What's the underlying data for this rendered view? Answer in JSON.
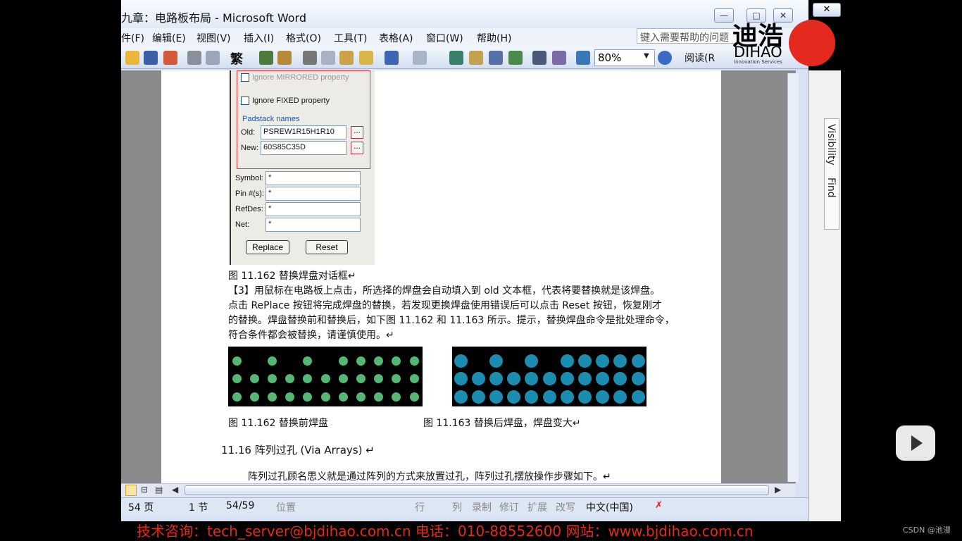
{
  "window": {
    "title": "九章：电路板布局 - Microsoft Word",
    "controls": {
      "min": "—",
      "max": "□",
      "close": "✕"
    }
  },
  "menu": {
    "items": [
      "件(F)",
      "编辑(E)",
      "视图(V)",
      "插入(I)",
      "格式(O)",
      "工具(T)",
      "表格(A)",
      "窗口(W)",
      "帮助(H)"
    ],
    "help_placeholder": "键入需要帮助的问题"
  },
  "toolbar": {
    "icons": [
      "open-icon",
      "save-icon",
      "permission-icon",
      "print-icon",
      "preview-icon",
      "trad-chinese-icon",
      "spell-icon",
      "research-icon",
      "cut-icon",
      "copy-icon",
      "paste-icon",
      "format-painter-icon",
      "undo-icon",
      "redo-icon",
      "hyperlink-icon",
      "tables-borders-icon",
      "insert-table-icon",
      "insert-excel-icon",
      "columns-icon",
      "drawing-icon",
      "doc-map-icon"
    ],
    "trad_label": "繁",
    "zoom": "80%",
    "read_label": "阅读(R"
  },
  "dialog": {
    "ignore_mirrored": "Ignore MIRRORED property",
    "ignore_fixed": "Ignore FIXED property",
    "padstack_group": "Padstack names",
    "old_label": "Old:",
    "old_value": "PSREW1R15H1R10",
    "new_label": "New:",
    "new_value": "60S85C35D",
    "browse": "...",
    "symbol_label": "Symbol:",
    "pin_label": "Pin #(s):",
    "refdes_label": "RefDes:",
    "net_label": "Net:",
    "wildcard": "*",
    "replace_btn": "Replace",
    "reset_btn": "Reset"
  },
  "doc": {
    "fig_caption_dialog": "图 11.162 替换焊盘对话框↵",
    "para_lines": [
      "【3】用鼠标在电路板上点击，所选择的焊盘会自动填入到 old 文本框，代表将要替换就是该焊盘。",
      "点击 RePlace 按钮将完成焊盘的替换，若发现更换焊盘使用错误后可以点击 Reset 按钮，恢复刚才",
      "的替换。焊盘替换前和替换后，如下图 11.162 和 11.163 所示。提示，替换焊盘命令是批处理命令，",
      "符合条件都会被替换，请谨慎使用。↵"
    ],
    "caption_before": "图 11.162 替换前焊盘",
    "caption_after": "图 11.163 替换后焊盘，焊盘变大↵",
    "section_heading": "11.16 阵列过孔 (Via Arrays) ↵",
    "section_body": "阵列过孔顾名思义就是通过阵列的方式来放置过孔，阵列过孔摆放操作步骤如下。↵"
  },
  "status": {
    "page": "54 页",
    "section": "1 节",
    "pages": "54/59",
    "position": "位置",
    "line": "行",
    "col": "列",
    "rec": "录制",
    "trk": "修订",
    "ext": "扩展",
    "ovr": "改写",
    "lang": "中文(中国)"
  },
  "side_panel": {
    "visibility": "Visibility",
    "find": "Find"
  },
  "logo": {
    "name": "迪浩",
    "latin": "DIHAO",
    "tagline": "Innovation Services"
  },
  "banner": "技术咨询：tech_server@bjdihao.com.cn    电话：010-88552600    网站：www.bjdihao.com.cn",
  "csdn": "CSDN @池漫",
  "colors": {
    "pad_before": "#54b774",
    "pad_after": "#1b8db0",
    "banner": "#e32b1c"
  }
}
